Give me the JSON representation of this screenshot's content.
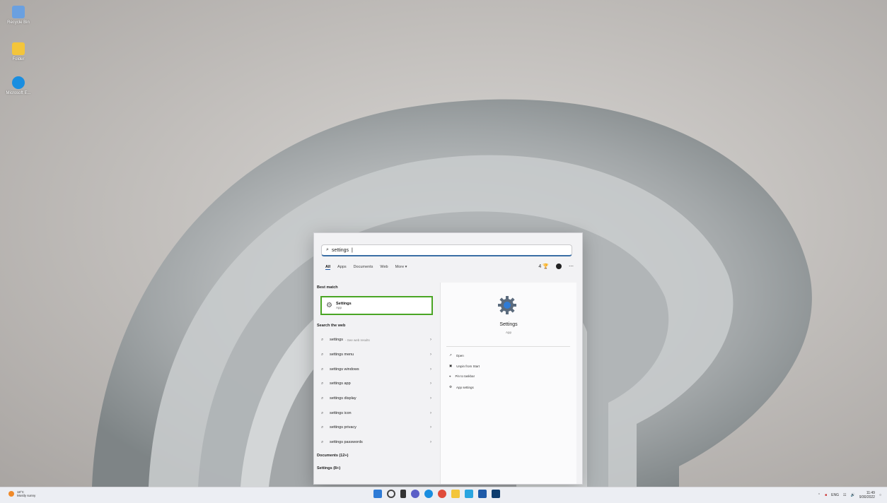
{
  "desktop": {
    "icons": [
      {
        "label": "Recycle Bin",
        "icon": "recycle-bin-icon",
        "color": "#6aa0e0"
      },
      {
        "label": "Folder",
        "icon": "folder-icon",
        "color": "#f3c53b"
      },
      {
        "label": "Microsoft E...",
        "icon": "edge-icon",
        "color": "#1a8ee0"
      }
    ]
  },
  "search": {
    "query": "settings",
    "tabs": [
      "All",
      "Apps",
      "Documents",
      "Web",
      "More"
    ],
    "active_tab": "All",
    "points": "4"
  },
  "results": {
    "best_match_title": "Best match",
    "best": {
      "name": "Settings",
      "type": "App"
    },
    "web_title": "Search the web",
    "web_items": [
      {
        "text": "settings",
        "hint": "- See web results"
      },
      {
        "text": "settings menu",
        "hint": ""
      },
      {
        "text": "settings windows",
        "hint": ""
      },
      {
        "text": "settings app",
        "hint": ""
      },
      {
        "text": "settings display",
        "hint": ""
      },
      {
        "text": "settings icon",
        "hint": ""
      },
      {
        "text": "settings privacy",
        "hint": ""
      },
      {
        "text": "settings passwords",
        "hint": ""
      }
    ],
    "documents": "Documents (12+)",
    "settings": "Settings (8+)"
  },
  "detail": {
    "title": "Settings",
    "subtitle": "App",
    "actions": [
      "Open",
      "Unpin from Start",
      "Pin to taskbar",
      "App settings"
    ]
  },
  "taskbar": {
    "weather_temp": "18°C",
    "weather_desc": "Mostly sunny",
    "lang": "ENG",
    "time": "11:49",
    "date": "9/30/2022"
  },
  "colors": {
    "highlight": "#4aa524",
    "accent": "#1e5aa8"
  }
}
